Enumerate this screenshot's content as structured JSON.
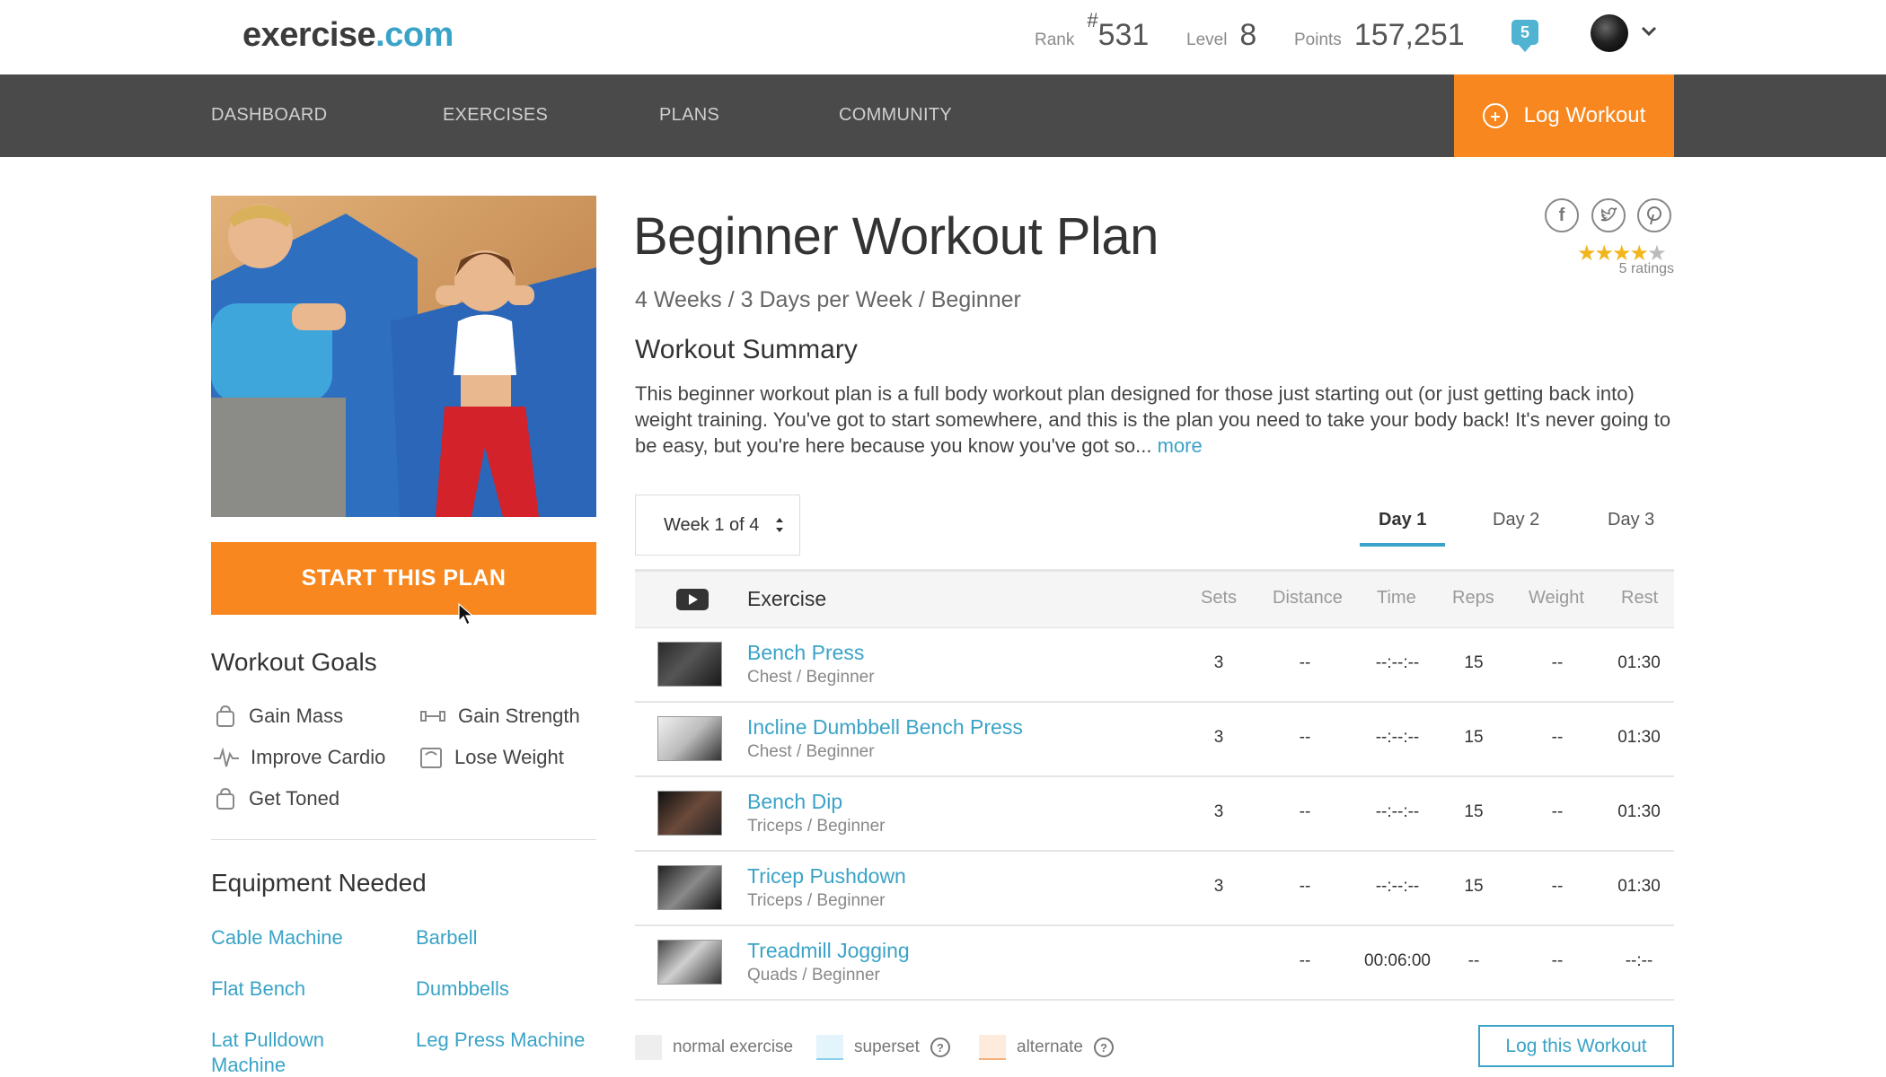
{
  "header": {
    "logo_part1": "exercise",
    "logo_part2": ".com",
    "rank_label": "Rank",
    "rank_hash": "#",
    "rank_value": "531",
    "level_label": "Level",
    "level_value": "8",
    "points_label": "Points",
    "points_value": "157,251",
    "notification_count": "5",
    "icons": {
      "notification": "chat-bubble-icon",
      "avatar": "user-avatar",
      "menu": "chevron-down-icon"
    }
  },
  "nav": {
    "items": [
      {
        "label": "DASHBOARD"
      },
      {
        "label": "EXERCISES"
      },
      {
        "label": "PLANS"
      },
      {
        "label": "COMMUNITY"
      }
    ],
    "log_workout_label": "Log Workout"
  },
  "left": {
    "start_button_label": "START THIS PLAN",
    "goals_title": "Workout Goals",
    "goals": [
      {
        "label": "Gain Mass",
        "icon": "kettlebell-icon"
      },
      {
        "label": "Gain Strength",
        "icon": "dumbbell-icon"
      },
      {
        "label": "Improve Cardio",
        "icon": "heartbeat-icon"
      },
      {
        "label": "Lose Weight",
        "icon": "scale-icon"
      },
      {
        "label": "Get Toned",
        "icon": "kettlebell-icon"
      }
    ],
    "equipment_title": "Equipment Needed",
    "equipment": [
      {
        "label": "Cable Machine"
      },
      {
        "label": "Barbell"
      },
      {
        "label": "Flat Bench"
      },
      {
        "label": "Dumbbells"
      },
      {
        "label": "Lat Pulldown Machine"
      },
      {
        "label": "Leg Press Machine"
      }
    ]
  },
  "plan": {
    "title": "Beginner Workout Plan",
    "subtitle": "4 Weeks / 3 Days per Week / Beginner",
    "rating_stars": 4,
    "rating_max": 5,
    "ratings_label": "5 ratings",
    "summary_title": "Workout Summary",
    "summary_text": "This beginner workout plan is a full body workout plan designed for those just starting out (or just getting back into) weight training. You've got to start somewhere, and this is the plan you need to take your body back! It's never going to be easy, but you're here because you know you've got so... ",
    "more_link": "more",
    "week_select": "Week 1 of 4",
    "days": [
      {
        "label": "Day 1",
        "active": true
      },
      {
        "label": "Day 2",
        "active": false
      },
      {
        "label": "Day 3",
        "active": false
      }
    ]
  },
  "table": {
    "headers": {
      "exercise": "Exercise",
      "sets": "Sets",
      "distance": "Distance",
      "time": "Time",
      "reps": "Reps",
      "weight": "Weight",
      "rest": "Rest"
    },
    "rows": [
      {
        "name": "Bench Press",
        "category": "Chest / Beginner",
        "sets": "3",
        "distance": "--",
        "time": "--:--:--",
        "reps": "15",
        "weight": "--",
        "rest": "01:30"
      },
      {
        "name": "Incline Dumbbell Bench Press",
        "category": "Chest / Beginner",
        "sets": "3",
        "distance": "--",
        "time": "--:--:--",
        "reps": "15",
        "weight": "--",
        "rest": "01:30"
      },
      {
        "name": "Bench Dip",
        "category": "Triceps / Beginner",
        "sets": "3",
        "distance": "--",
        "time": "--:--:--",
        "reps": "15",
        "weight": "--",
        "rest": "01:30"
      },
      {
        "name": "Tricep Pushdown",
        "category": "Triceps / Beginner",
        "sets": "3",
        "distance": "--",
        "time": "--:--:--",
        "reps": "15",
        "weight": "--",
        "rest": "01:30"
      },
      {
        "name": "Treadmill Jogging",
        "category": "Quads / Beginner",
        "sets": "",
        "distance": "--",
        "time": "00:06:00",
        "reps": "--",
        "weight": "--",
        "rest": "--:--"
      }
    ]
  },
  "legend": {
    "normal": "normal exercise",
    "superset": "superset",
    "alternate": "alternate",
    "help_glyph": "?"
  },
  "log_this_workout_label": "Log this Workout",
  "colors": {
    "accent_orange": "#f7871e",
    "link_blue": "#3aa3c7",
    "nav_bg": "#4a4a4a",
    "star": "#f2b51c"
  }
}
